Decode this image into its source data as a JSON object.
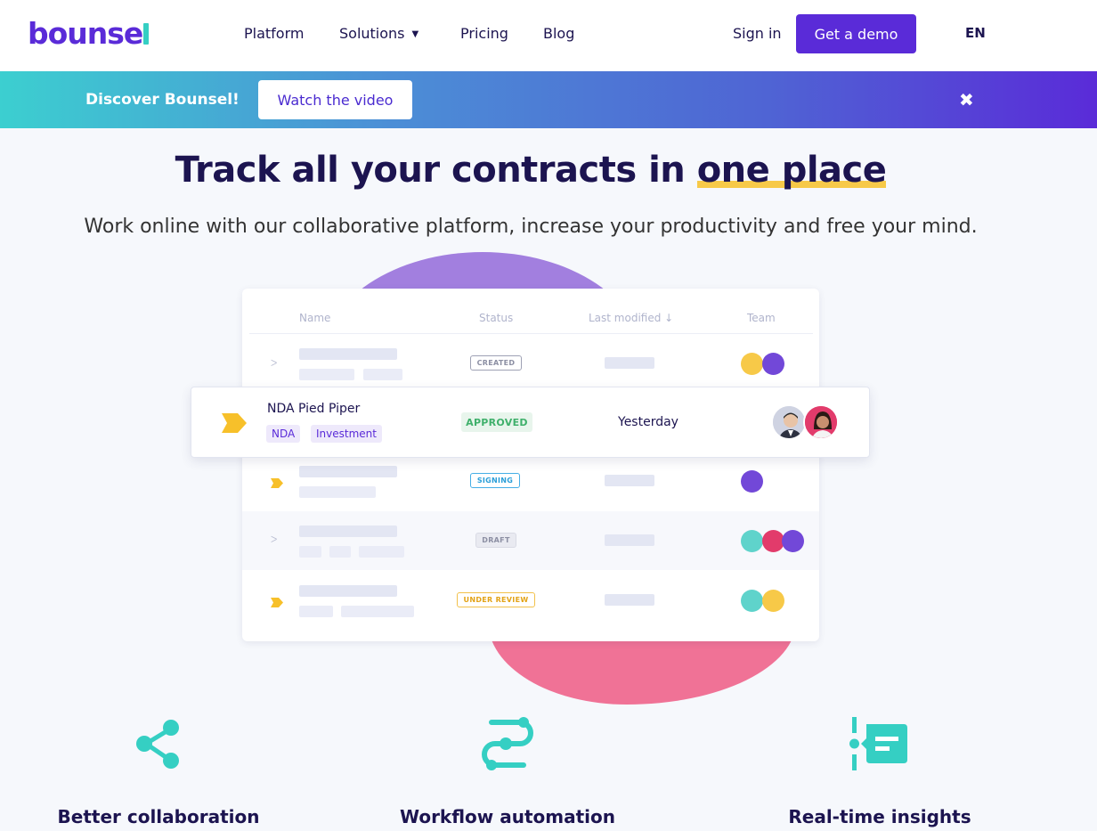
{
  "brand": {
    "name": "bounse",
    "accent": "#5a2bd8",
    "teal": "#35cfc3"
  },
  "nav": {
    "platform": "Platform",
    "solutions": "Solutions",
    "pricing": "Pricing",
    "blog": "Blog",
    "sign_in": "Sign in",
    "demo": "Get a demo",
    "language": "EN"
  },
  "banner": {
    "text": "Discover Bounsel!",
    "button": "Watch the video",
    "close_icon": "✖"
  },
  "hero": {
    "title_prefix": "Track all your contracts in ",
    "title_highlight": "one place",
    "subtitle": "Work online with our collaborative platform, increase your productivity and free your mind."
  },
  "table": {
    "headers": {
      "name": "Name",
      "status": "Status",
      "last_modified": "Last modified ↓",
      "team": "Team"
    },
    "statuses": {
      "created": "CREATED",
      "signing": "SIGNING",
      "draft": "DRAFT",
      "under_review": "UNDER REVIEW"
    },
    "featured": {
      "title": "NDA Pied Piper",
      "tags": [
        "NDA",
        "Investment"
      ],
      "status": "APPROVED",
      "modified": "Yesterday"
    }
  },
  "features": [
    {
      "label": "Better collaboration",
      "icon": "share-icon"
    },
    {
      "label": "Workflow automation",
      "icon": "workflow-icon"
    },
    {
      "label": "Real-time insights",
      "icon": "insights-icon"
    }
  ]
}
